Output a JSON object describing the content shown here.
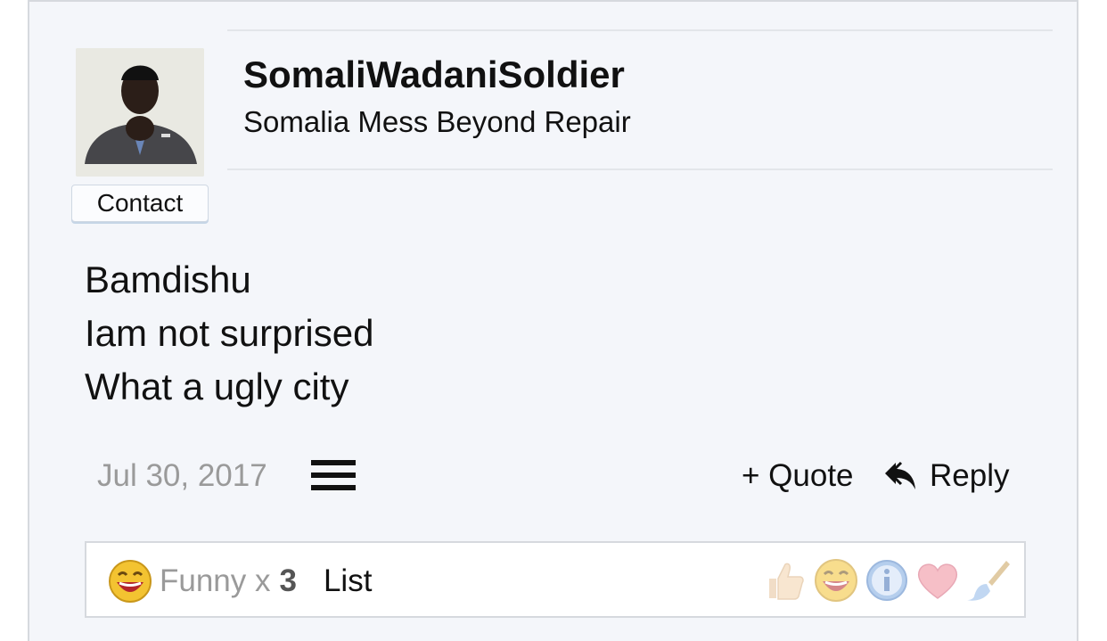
{
  "user": {
    "name": "SomaliWadaniSoldier",
    "title": "Somalia Mess Beyond Repair",
    "contact_label": "Contact"
  },
  "message": {
    "lines": [
      "Bamdishu",
      "Iam not surprised",
      "What a ugly city"
    ]
  },
  "footer": {
    "date": "Jul 30, 2017",
    "menu_icon": "hamburger-icon",
    "quote_label": "+ Quote",
    "reply_label": "Reply",
    "reply_icon": "reply-arrow-icon"
  },
  "reactions": {
    "summary_icon": "laughing-emoji-icon",
    "label": "Funny x",
    "count": "3",
    "list_label": "List",
    "buttons": [
      "thumbs-up-icon",
      "laughing-emoji-icon",
      "info-icon",
      "heart-icon",
      "paintbrush-icon"
    ]
  },
  "colors": {
    "background": "#f4f6fa",
    "muted_text": "#9a9a9a",
    "border": "#d6d9de"
  }
}
